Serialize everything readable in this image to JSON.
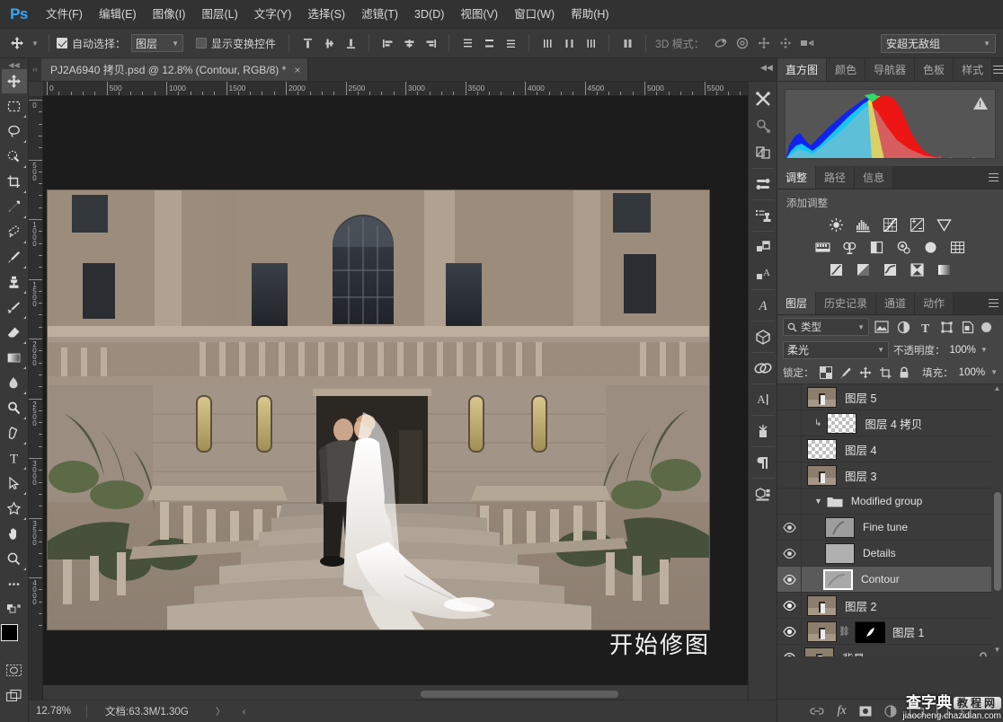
{
  "app": {
    "logo": "Ps"
  },
  "menubar": {
    "items": [
      {
        "label": "文件(F)"
      },
      {
        "label": "编辑(E)"
      },
      {
        "label": "图像(I)"
      },
      {
        "label": "图层(L)"
      },
      {
        "label": "文字(Y)"
      },
      {
        "label": "选择(S)"
      },
      {
        "label": "滤镜(T)"
      },
      {
        "label": "3D(D)"
      },
      {
        "label": "视图(V)"
      },
      {
        "label": "窗口(W)"
      },
      {
        "label": "帮助(H)"
      }
    ]
  },
  "options_bar": {
    "tool": "move-tool",
    "auto_select_checked": true,
    "auto_select_label": "自动选择：",
    "auto_select_value": "图层",
    "show_transform_checked": false,
    "show_transform_label": "显示变换控件",
    "mode_3d_label": "3D 模式：",
    "group_select_value": "安超无敌组"
  },
  "document": {
    "tab_title": "PJ2A6940 拷贝.psd @ 12.8% (Contour, RGB/8) *",
    "close_glyph": "×",
    "canvas_text": "开始修图",
    "ruler_h_labels": [
      "0",
      "500",
      "1000",
      "1500",
      "2000",
      "2500",
      "3000",
      "3500",
      "4000",
      "4500",
      "5000",
      "5500"
    ],
    "ruler_v_labels": [
      "0",
      "500",
      "1000",
      "1500",
      "2000",
      "2500",
      "3000",
      "3500",
      "4000"
    ]
  },
  "statusbar": {
    "zoom": "12.78%",
    "doc_info": "文档:63.3M/1.30G",
    "arrows": "〉 ‹"
  },
  "toolbar": {
    "tools": [
      {
        "name": "move-tool",
        "active": true
      },
      {
        "name": "rectangular-marquee-tool",
        "active": false
      },
      {
        "name": "lasso-tool",
        "active": false
      },
      {
        "name": "quick-selection-tool",
        "active": false
      },
      {
        "name": "crop-tool",
        "active": false
      },
      {
        "name": "eyedropper-tool",
        "active": false
      },
      {
        "name": "spot-healing-brush-tool",
        "active": false
      },
      {
        "name": "brush-tool",
        "active": false
      },
      {
        "name": "clone-stamp-tool",
        "active": false
      },
      {
        "name": "history-brush-tool",
        "active": false
      },
      {
        "name": "eraser-tool",
        "active": false
      },
      {
        "name": "gradient-tool",
        "active": false
      },
      {
        "name": "blur-tool",
        "active": false
      },
      {
        "name": "dodge-tool",
        "active": false
      },
      {
        "name": "pen-tool",
        "active": false
      },
      {
        "name": "horizontal-type-tool",
        "active": false
      },
      {
        "name": "path-selection-tool",
        "active": false
      },
      {
        "name": "custom-shape-tool",
        "active": false
      },
      {
        "name": "hand-tool",
        "active": false
      },
      {
        "name": "zoom-tool",
        "active": false
      },
      {
        "name": "edit-toolbar-tool",
        "active": false
      }
    ],
    "foreground_color": "#000000",
    "background_color": "#ffffff"
  },
  "dock": {
    "items": [
      "3d-materials-icon",
      "3d-secondary-icon",
      "3d-shape-icon",
      "properties-icon",
      "brush-presets-icon",
      "layer-comps-icon",
      "character-styles-icon",
      "glyphs-icon",
      "3d-panel-icon",
      "actions-link-icon",
      "type-panel-icon",
      "library-icon",
      "paragraph-icon",
      "measure-log-icon"
    ]
  },
  "histogram_panel": {
    "tabs": [
      {
        "label": "直方图",
        "active": true
      },
      {
        "label": "颜色",
        "active": false
      },
      {
        "label": "导航器",
        "active": false
      },
      {
        "label": "色板",
        "active": false
      },
      {
        "label": "样式",
        "active": false
      }
    ],
    "warning_icon": "uncached-data-warning-icon"
  },
  "adjustments_panel": {
    "tabs": [
      {
        "label": "调整",
        "active": true
      },
      {
        "label": "路径",
        "active": false
      },
      {
        "label": "信息",
        "active": false
      }
    ],
    "title": "添加调整",
    "row1": [
      "brightness-contrast-icon",
      "levels-icon",
      "curves-icon",
      "exposure-icon",
      "vibrance-icon"
    ],
    "row2": [
      "hue-saturation-icon",
      "color-balance-icon",
      "black-white-icon",
      "photo-filter-icon",
      "channel-mixer-icon",
      "color-lookup-icon"
    ],
    "row3": [
      "invert-icon",
      "posterize-icon",
      "threshold-icon",
      "selective-color-icon",
      "gradient-map-icon"
    ]
  },
  "layers_panel": {
    "tabs": [
      {
        "label": "图层",
        "active": true
      },
      {
        "label": "历史记录",
        "active": false
      },
      {
        "label": "通道",
        "active": false
      },
      {
        "label": "动作",
        "active": false
      }
    ],
    "filter_value": "类型",
    "filter_icons": [
      "pixel-filter-icon",
      "adjustment-filter-icon",
      "type-filter-icon",
      "shape-filter-icon",
      "smart-object-filter-icon"
    ],
    "blend_mode": "柔光",
    "opacity_label": "不透明度：",
    "opacity_value": "100%",
    "lock_label": "锁定：",
    "lock_icons": [
      "lock-transparent-pixels-icon",
      "lock-image-pixels-icon",
      "lock-position-icon",
      "lock-artboard-icon",
      "lock-all-icon"
    ],
    "fill_label": "填充：",
    "fill_value": "100%",
    "layers": [
      {
        "name": "图层 5",
        "visible": false,
        "selected": false,
        "kind": "image",
        "indent": 0,
        "clipped": false,
        "locked": false
      },
      {
        "name": "图层 4 拷贝",
        "visible": false,
        "selected": false,
        "kind": "transparent",
        "indent": 1,
        "clipped": true,
        "locked": false
      },
      {
        "name": "图层 4",
        "visible": false,
        "selected": false,
        "kind": "transparent",
        "indent": 0,
        "clipped": false,
        "locked": false
      },
      {
        "name": "图层 3",
        "visible": false,
        "selected": false,
        "kind": "image",
        "indent": 0,
        "clipped": false,
        "locked": false
      },
      {
        "name": "Modified group",
        "visible": false,
        "selected": false,
        "kind": "group",
        "indent": 0,
        "clipped": false,
        "locked": false
      },
      {
        "name": "Fine tune",
        "visible": true,
        "selected": false,
        "kind": "gray",
        "indent": 1,
        "clipped": false,
        "locked": false
      },
      {
        "name": "Details",
        "visible": true,
        "selected": false,
        "kind": "gray",
        "indent": 1,
        "clipped": false,
        "locked": false
      },
      {
        "name": "Contour",
        "visible": true,
        "selected": true,
        "kind": "gray",
        "indent": 1,
        "clipped": false,
        "locked": false
      },
      {
        "name": "图层 2",
        "visible": true,
        "selected": false,
        "kind": "image",
        "indent": 0,
        "clipped": false,
        "locked": false
      },
      {
        "name": "图层 1",
        "visible": true,
        "selected": false,
        "kind": "image-mask",
        "indent": 0,
        "clipped": false,
        "locked": false
      },
      {
        "name": "背景",
        "visible": true,
        "selected": false,
        "kind": "background",
        "indent": 0,
        "clipped": false,
        "locked": true
      }
    ],
    "footer_icons": [
      "link-layers-icon",
      "layer-style-fx-icon",
      "add-layer-mask-icon",
      "new-adjustment-icon",
      "new-group-icon",
      "new-layer-icon",
      "delete-layer-icon"
    ]
  },
  "watermark": {
    "cn": "查字典",
    "box": "教程网",
    "url": "jiaocheng.chazidian.com"
  }
}
